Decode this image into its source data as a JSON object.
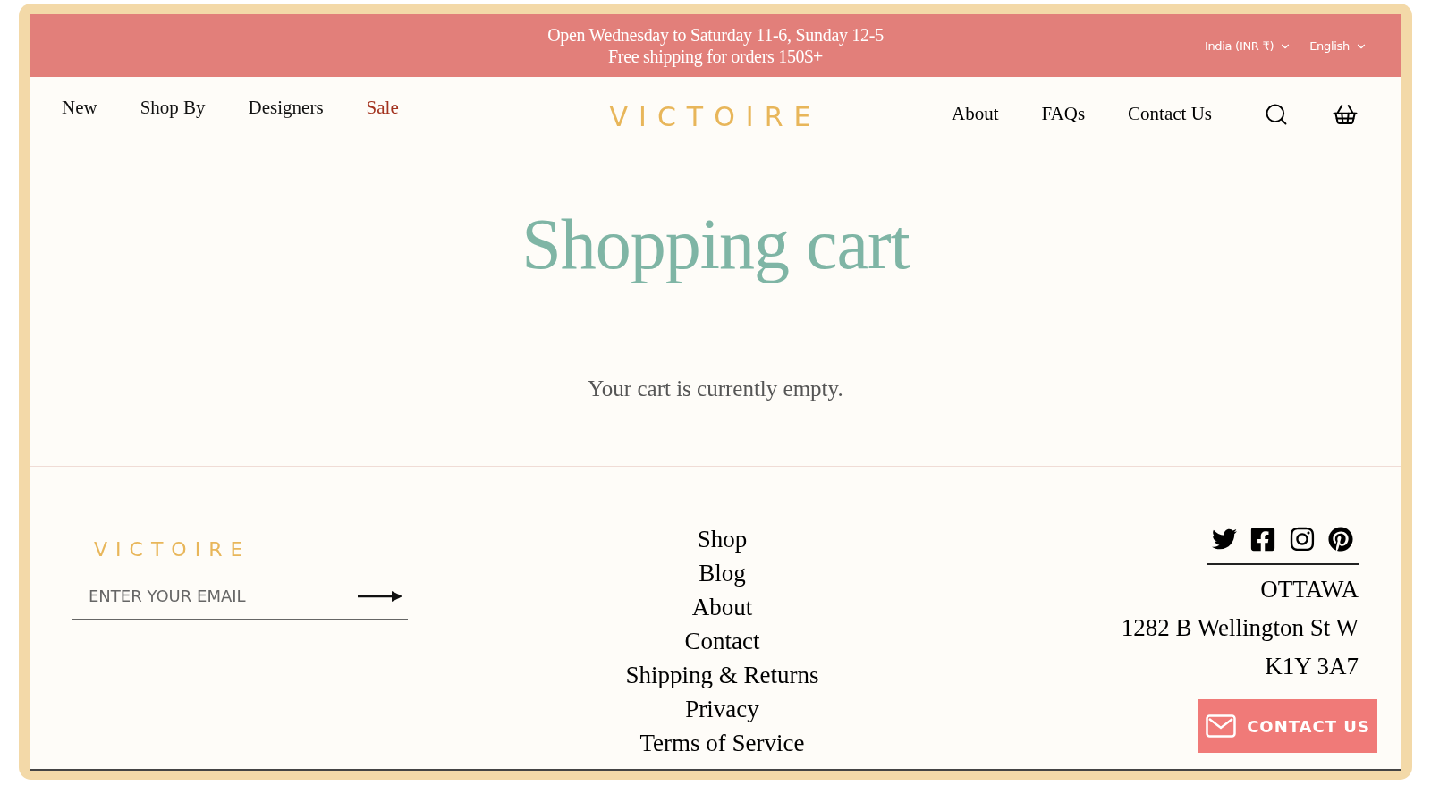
{
  "announcement": {
    "lines": [
      "Open Wednesday to Saturday 11-6, Sunday 12-5",
      "Free shipping for orders 150$+"
    ],
    "country": "India (INR ₹)",
    "language": "English"
  },
  "header": {
    "logo": "VICTOIRE",
    "left_nav": [
      {
        "label": "New",
        "kind": "normal"
      },
      {
        "label": "Shop By",
        "kind": "normal"
      },
      {
        "label": "Designers",
        "kind": "normal"
      },
      {
        "label": "Sale",
        "kind": "sale"
      }
    ],
    "right_nav": [
      "About",
      "FAQs",
      "Contact Us"
    ]
  },
  "main": {
    "title": "Shopping cart",
    "empty_message": "Your cart is currently empty."
  },
  "footer": {
    "logo": "VICTOIRE",
    "email": {
      "placeholder": "ENTER YOUR EMAIL"
    },
    "links": [
      "Shop",
      "Blog",
      "About",
      "Contact",
      "Shipping & Returns",
      "Privacy",
      "Terms of Service"
    ],
    "address": [
      "OTTAWA",
      "1282 B Wellington St W",
      "K1Y 3A7"
    ]
  },
  "contact_button": {
    "label": "CONTACT US"
  }
}
